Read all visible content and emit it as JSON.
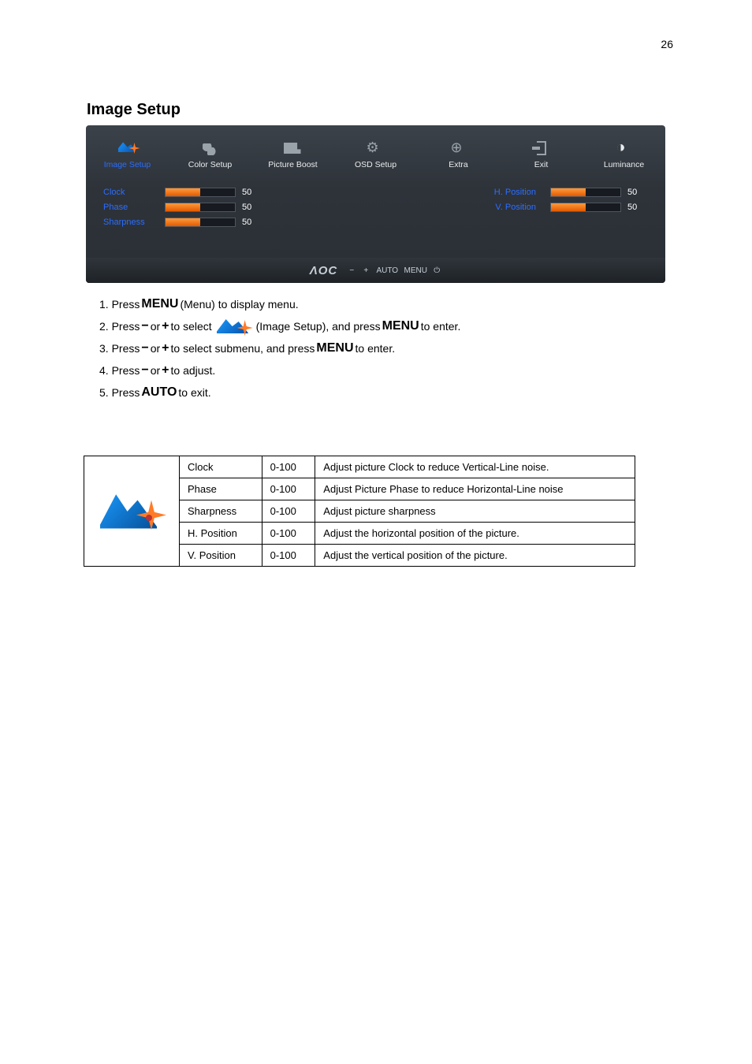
{
  "page_number": "26",
  "section_title": "Image Setup",
  "osd": {
    "tabs": [
      {
        "label": "Image Setup",
        "active": true
      },
      {
        "label": "Color Setup",
        "active": false
      },
      {
        "label": "Picture Boost",
        "active": false
      },
      {
        "label": "OSD Setup",
        "active": false
      },
      {
        "label": "Extra",
        "active": false
      },
      {
        "label": "Exit",
        "active": false
      },
      {
        "label": "Luminance",
        "active": false
      }
    ],
    "items_left": [
      {
        "label": "Clock",
        "value": "50"
      },
      {
        "label": "Phase",
        "value": "50"
      },
      {
        "label": "Sharpness",
        "value": "50"
      }
    ],
    "items_right": [
      {
        "label": "H. Position",
        "value": "50"
      },
      {
        "label": "V. Position",
        "value": "50"
      }
    ],
    "footer": {
      "logo": "ΛOC",
      "btn_minus": "−",
      "btn_plus": "+",
      "btn_auto": "AUTO",
      "btn_menu": "MENU",
      "btn_power": "⏻"
    }
  },
  "instr": {
    "l1a": "1. Press ",
    "l1_menu": "MENU",
    "l1b": " (Menu) to display menu.",
    "l2a": "2. Press ",
    "l2_minus": "−",
    "l2_or1": " or ",
    "l2_plus": "+",
    "l2b": "  to select ",
    "l2c": " (Image Setup), and press ",
    "l2_menu": "MENU",
    "l2d": " to enter.",
    "l3a": "3. Press ",
    "l3_minus": "−",
    "l3_or1": " or ",
    "l3_plus": "+",
    "l3b": "  to select submenu, and press ",
    "l3_menu": "MENU",
    "l3c": " to enter.",
    "l4a": "4. Press ",
    "l4_minus": "−",
    "l4_or1": " or ",
    "l4_plus": "+",
    "l4b": "  to adjust.",
    "l5a": "5. Press ",
    "l5_auto": "AUTO",
    "l5b": " to exit."
  },
  "table": {
    "rows": [
      {
        "name": "Clock",
        "range": "0-100",
        "desc": "Adjust picture Clock to reduce Vertical-Line noise."
      },
      {
        "name": "Phase",
        "range": "0-100",
        "desc": "Adjust Picture Phase to reduce Horizontal-Line noise"
      },
      {
        "name": "Sharpness",
        "range": "0-100",
        "desc": "Adjust picture sharpness"
      },
      {
        "name": "H. Position",
        "range": "0-100",
        "desc": "Adjust the horizontal position of the picture."
      },
      {
        "name": "V. Position",
        "range": "0-100",
        "desc": "Adjust the vertical position of the picture."
      }
    ]
  }
}
